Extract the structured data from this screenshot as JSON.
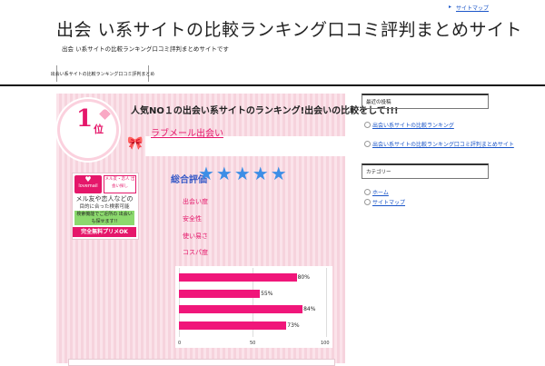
{
  "header": {
    "top_link": "サイトマップ",
    "site_title": "出会 い系サイトの比較ランキング口コミ評判まとめサイト",
    "tagline": "出会 い系サイトの比較ランキング口コミ評判まとめサイトです",
    "nav_item": "出会い系サイトの比較ランキング口コミ評判まとめ"
  },
  "main": {
    "headline": "人気NO１の出会い系サイトのランキング!出会いの比較をして!!!",
    "rank_number": "1",
    "rank_suffix": "位",
    "site_name": "ラブメール出会い",
    "thumb": {
      "logo": "lovemail",
      "tag": "メル友・恋人 出会い探し",
      "line1": "メル友や恋人などの",
      "line2": "目的に合った検索可能",
      "line3": "検索機能でご近所の 出会いも探せます!!",
      "line4": "完全無料プリメOK"
    },
    "eval_label": "総合評価",
    "stars": "★★★★★",
    "criteria": [
      "出会い度",
      "安全性",
      "使い易さ",
      "コスパ度"
    ]
  },
  "chart_data": {
    "type": "bar",
    "orientation": "horizontal",
    "values": [
      80,
      55,
      84,
      73
    ],
    "value_labels": [
      "80%",
      "55%",
      "84%",
      "73%"
    ],
    "xlim": [
      0,
      100
    ],
    "xticks": [
      "0",
      "50",
      "100"
    ],
    "colors": {
      "bar": "#f0167a"
    }
  },
  "sidebar": {
    "widget1_title": "最近の投稿",
    "widget1_items": [
      "出会い系サイトの比較ランキング",
      "出会い系サイトの比較ランキング口コミ評判まとめサイト"
    ],
    "widget2_title": "カテゴリー",
    "widget2_items": [
      "ホーム",
      "サイトマップ"
    ]
  }
}
